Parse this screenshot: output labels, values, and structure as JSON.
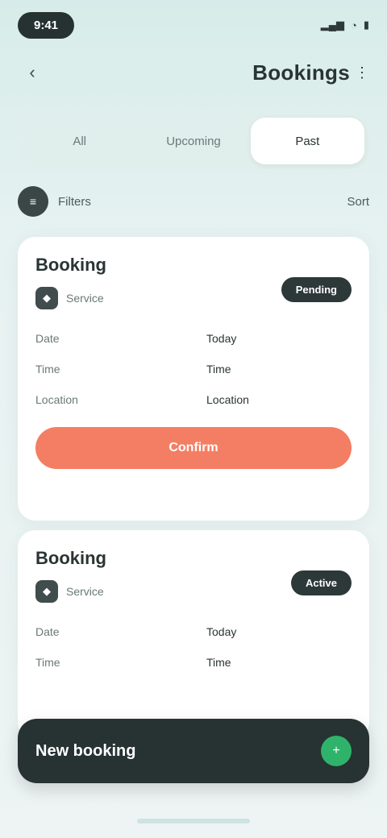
{
  "status": {
    "time": "9:41"
  },
  "header": {
    "title": "Bookings"
  },
  "tabs": [
    {
      "label": "All"
    },
    {
      "label": "Upcoming"
    },
    {
      "label": "Past"
    }
  ],
  "filter": {
    "label": "Filters",
    "sort": "Sort"
  },
  "cards": [
    {
      "title": "Booking",
      "subtitle": "Service",
      "badge": "Pending",
      "rows": [
        {
          "k": "Date",
          "v": "Today"
        },
        {
          "k": "Time",
          "v": "Time"
        },
        {
          "k": "Location",
          "v": "Location"
        }
      ],
      "cta": "Confirm"
    },
    {
      "title": "Booking",
      "subtitle": "Service",
      "badge": "Active",
      "rows": [
        {
          "k": "Date",
          "v": "Today"
        },
        {
          "k": "Time",
          "v": "Time"
        }
      ]
    }
  ],
  "bottom": {
    "title": "New booking"
  },
  "colors": {
    "accent": "#f47e64",
    "dark": "#273232",
    "success": "#2fb36b"
  },
  "icons": {
    "back": "chevron-left-icon",
    "bottom_action": "plus-icon"
  }
}
